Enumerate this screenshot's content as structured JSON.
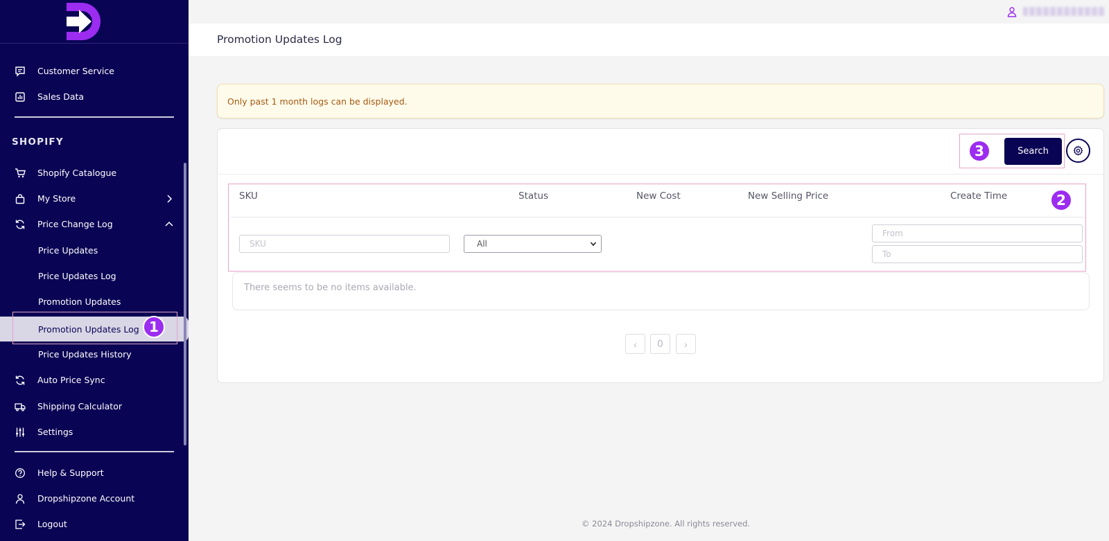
{
  "sidebar": {
    "top_items": [
      {
        "label": "Customer Service",
        "icon": "chat-icon"
      },
      {
        "label": "Sales Data",
        "icon": "chart-icon"
      }
    ],
    "section_title": "SHOPIFY",
    "shopify_items": [
      {
        "label": "Shopify Catalogue",
        "icon": "cart-icon"
      },
      {
        "label": "My Store",
        "icon": "bag-icon"
      },
      {
        "label": "Price Change Log",
        "icon": "refresh-icon"
      }
    ],
    "sub_items": [
      {
        "label": "Price Updates"
      },
      {
        "label": "Price Updates Log"
      },
      {
        "label": "Promotion Updates"
      },
      {
        "label": "Promotion Updates Log"
      },
      {
        "label": "Price Updates History"
      }
    ],
    "more_items": [
      {
        "label": "Auto Price Sync",
        "icon": "refresh-icon"
      },
      {
        "label": "Shipping Calculator",
        "icon": "truck-icon"
      },
      {
        "label": "Settings",
        "icon": "sliders-icon"
      }
    ],
    "bottom_items": [
      {
        "label": "Help & Support",
        "icon": "help-icon"
      },
      {
        "label": "Dropshipzone Account",
        "icon": "user-icon"
      },
      {
        "label": "Logout",
        "icon": "logout-icon"
      }
    ],
    "active_item": "Promotion Updates Log"
  },
  "header": {
    "page_title": "Promotion Updates Log"
  },
  "alert": {
    "message": "Only past 1 month logs can be displayed."
  },
  "toolbar": {
    "search_label": "Search"
  },
  "table": {
    "columns": [
      "SKU",
      "Status",
      "New Cost",
      "New Selling Price",
      "Create Time"
    ],
    "filters": {
      "sku_placeholder": "SKU",
      "status_value": "All",
      "from_placeholder": "From",
      "to_placeholder": "To"
    },
    "empty_message": "There seems to be no items available."
  },
  "pagination": {
    "prev": "‹",
    "page": "0",
    "next": "›"
  },
  "footer": {
    "text": "© 2024 Dropshipzone. All rights reserved."
  },
  "annotations": [
    "1",
    "2",
    "3"
  ],
  "colors": {
    "sidebar_bg": "#0a0454",
    "accent": "#9b2cf0",
    "alert_text": "#a45a12"
  }
}
